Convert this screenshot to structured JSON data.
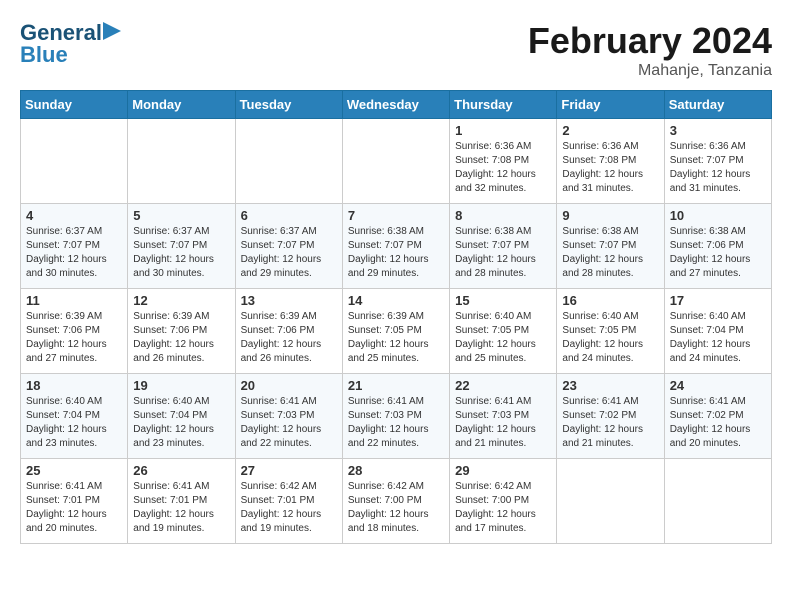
{
  "header": {
    "logo_line1": "General",
    "logo_line2": "Blue",
    "month_title": "February 2024",
    "location": "Mahanje, Tanzania"
  },
  "days_of_week": [
    "Sunday",
    "Monday",
    "Tuesday",
    "Wednesday",
    "Thursday",
    "Friday",
    "Saturday"
  ],
  "weeks": [
    [
      {
        "day": "",
        "info": ""
      },
      {
        "day": "",
        "info": ""
      },
      {
        "day": "",
        "info": ""
      },
      {
        "day": "",
        "info": ""
      },
      {
        "day": "1",
        "info": "Sunrise: 6:36 AM\nSunset: 7:08 PM\nDaylight: 12 hours\nand 32 minutes."
      },
      {
        "day": "2",
        "info": "Sunrise: 6:36 AM\nSunset: 7:08 PM\nDaylight: 12 hours\nand 31 minutes."
      },
      {
        "day": "3",
        "info": "Sunrise: 6:36 AM\nSunset: 7:07 PM\nDaylight: 12 hours\nand 31 minutes."
      }
    ],
    [
      {
        "day": "4",
        "info": "Sunrise: 6:37 AM\nSunset: 7:07 PM\nDaylight: 12 hours\nand 30 minutes."
      },
      {
        "day": "5",
        "info": "Sunrise: 6:37 AM\nSunset: 7:07 PM\nDaylight: 12 hours\nand 30 minutes."
      },
      {
        "day": "6",
        "info": "Sunrise: 6:37 AM\nSunset: 7:07 PM\nDaylight: 12 hours\nand 29 minutes."
      },
      {
        "day": "7",
        "info": "Sunrise: 6:38 AM\nSunset: 7:07 PM\nDaylight: 12 hours\nand 29 minutes."
      },
      {
        "day": "8",
        "info": "Sunrise: 6:38 AM\nSunset: 7:07 PM\nDaylight: 12 hours\nand 28 minutes."
      },
      {
        "day": "9",
        "info": "Sunrise: 6:38 AM\nSunset: 7:07 PM\nDaylight: 12 hours\nand 28 minutes."
      },
      {
        "day": "10",
        "info": "Sunrise: 6:38 AM\nSunset: 7:06 PM\nDaylight: 12 hours\nand 27 minutes."
      }
    ],
    [
      {
        "day": "11",
        "info": "Sunrise: 6:39 AM\nSunset: 7:06 PM\nDaylight: 12 hours\nand 27 minutes."
      },
      {
        "day": "12",
        "info": "Sunrise: 6:39 AM\nSunset: 7:06 PM\nDaylight: 12 hours\nand 26 minutes."
      },
      {
        "day": "13",
        "info": "Sunrise: 6:39 AM\nSunset: 7:06 PM\nDaylight: 12 hours\nand 26 minutes."
      },
      {
        "day": "14",
        "info": "Sunrise: 6:39 AM\nSunset: 7:05 PM\nDaylight: 12 hours\nand 25 minutes."
      },
      {
        "day": "15",
        "info": "Sunrise: 6:40 AM\nSunset: 7:05 PM\nDaylight: 12 hours\nand 25 minutes."
      },
      {
        "day": "16",
        "info": "Sunrise: 6:40 AM\nSunset: 7:05 PM\nDaylight: 12 hours\nand 24 minutes."
      },
      {
        "day": "17",
        "info": "Sunrise: 6:40 AM\nSunset: 7:04 PM\nDaylight: 12 hours\nand 24 minutes."
      }
    ],
    [
      {
        "day": "18",
        "info": "Sunrise: 6:40 AM\nSunset: 7:04 PM\nDaylight: 12 hours\nand 23 minutes."
      },
      {
        "day": "19",
        "info": "Sunrise: 6:40 AM\nSunset: 7:04 PM\nDaylight: 12 hours\nand 23 minutes."
      },
      {
        "day": "20",
        "info": "Sunrise: 6:41 AM\nSunset: 7:03 PM\nDaylight: 12 hours\nand 22 minutes."
      },
      {
        "day": "21",
        "info": "Sunrise: 6:41 AM\nSunset: 7:03 PM\nDaylight: 12 hours\nand 22 minutes."
      },
      {
        "day": "22",
        "info": "Sunrise: 6:41 AM\nSunset: 7:03 PM\nDaylight: 12 hours\nand 21 minutes."
      },
      {
        "day": "23",
        "info": "Sunrise: 6:41 AM\nSunset: 7:02 PM\nDaylight: 12 hours\nand 21 minutes."
      },
      {
        "day": "24",
        "info": "Sunrise: 6:41 AM\nSunset: 7:02 PM\nDaylight: 12 hours\nand 20 minutes."
      }
    ],
    [
      {
        "day": "25",
        "info": "Sunrise: 6:41 AM\nSunset: 7:01 PM\nDaylight: 12 hours\nand 20 minutes."
      },
      {
        "day": "26",
        "info": "Sunrise: 6:41 AM\nSunset: 7:01 PM\nDaylight: 12 hours\nand 19 minutes."
      },
      {
        "day": "27",
        "info": "Sunrise: 6:42 AM\nSunset: 7:01 PM\nDaylight: 12 hours\nand 19 minutes."
      },
      {
        "day": "28",
        "info": "Sunrise: 6:42 AM\nSunset: 7:00 PM\nDaylight: 12 hours\nand 18 minutes."
      },
      {
        "day": "29",
        "info": "Sunrise: 6:42 AM\nSunset: 7:00 PM\nDaylight: 12 hours\nand 17 minutes."
      },
      {
        "day": "",
        "info": ""
      },
      {
        "day": "",
        "info": ""
      }
    ]
  ]
}
